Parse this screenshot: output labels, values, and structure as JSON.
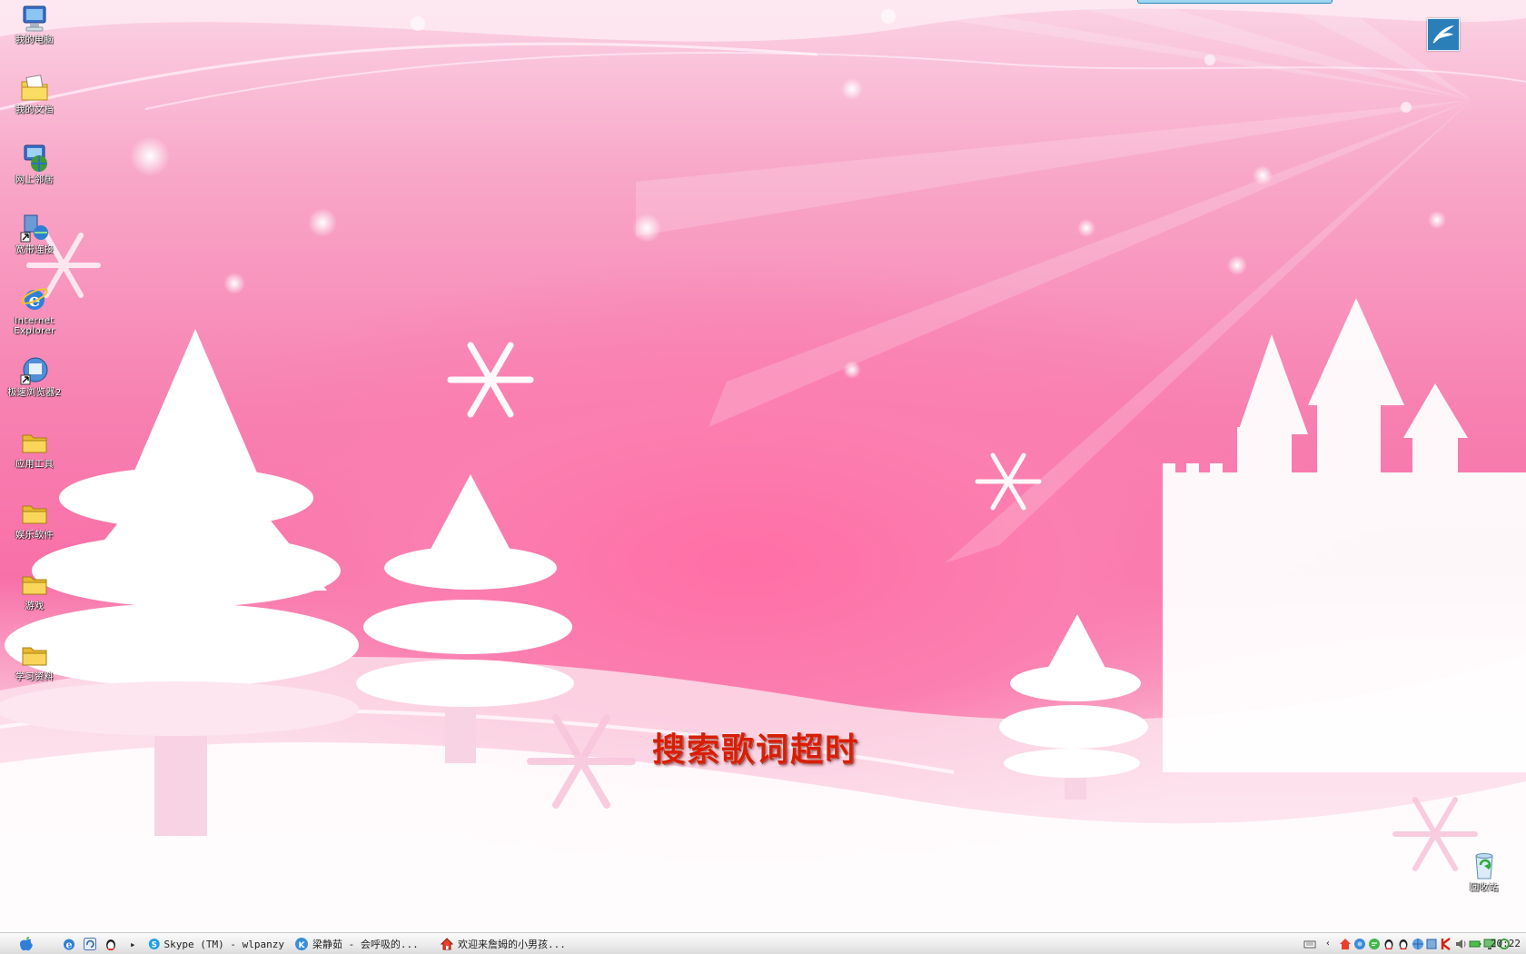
{
  "desktop": {
    "icons": [
      {
        "label": "我的电脑",
        "icon": "my-computer-icon"
      },
      {
        "label": "我的文档",
        "icon": "my-documents-icon"
      },
      {
        "label": "网上邻居",
        "icon": "network-places-icon"
      },
      {
        "label": "宽带连接",
        "icon": "broadband-connection-icon"
      },
      {
        "label": "Internet Explorer",
        "icon": "internet-explorer-icon"
      },
      {
        "label": "极速浏览器2",
        "icon": "browser-icon"
      },
      {
        "label": "应用工具",
        "icon": "folder-icon"
      },
      {
        "label": "娱乐软件",
        "icon": "folder-icon"
      },
      {
        "label": "游戏",
        "icon": "folder-icon"
      },
      {
        "label": "学习资料",
        "icon": "folder-icon"
      }
    ],
    "recycle_bin": {
      "label": "回收站",
      "icon": "recycle-bin-icon"
    },
    "lyric_status": "搜索歌词超时",
    "corner_widget": {
      "icon": "feather-icon"
    }
  },
  "taskbar": {
    "start_icon": "apple-icon",
    "quick_launch": [
      "internet-explorer-icon",
      "refresh-icon",
      "qq-penguin-icon"
    ],
    "expand_arrow": "▸",
    "tasks": [
      {
        "label": "Skype (TM) - wlpanzy",
        "icon": "skype-icon"
      },
      {
        "label": "梁静茹 - 会呼吸的...",
        "icon": "music-player-icon"
      },
      {
        "label": "欢迎来詹姆的小男孩...",
        "icon": "home-icon"
      }
    ],
    "tray_icons": [
      "keyboard-icon",
      "tray-arrow-icon",
      "home-icon",
      "network-icon",
      "chat-icon",
      "qq-icon",
      "qq-icon",
      "globe-icon",
      "update-icon",
      "kaspersky-icon",
      "volume-icon",
      "battery-icon",
      "display-icon",
      "refresh-icon"
    ],
    "clock": "20:22"
  },
  "colors": {
    "wallpaper_pink": "#f870a8",
    "lyric_red": "#d81e06",
    "taskbar_bg": "#ececec"
  }
}
